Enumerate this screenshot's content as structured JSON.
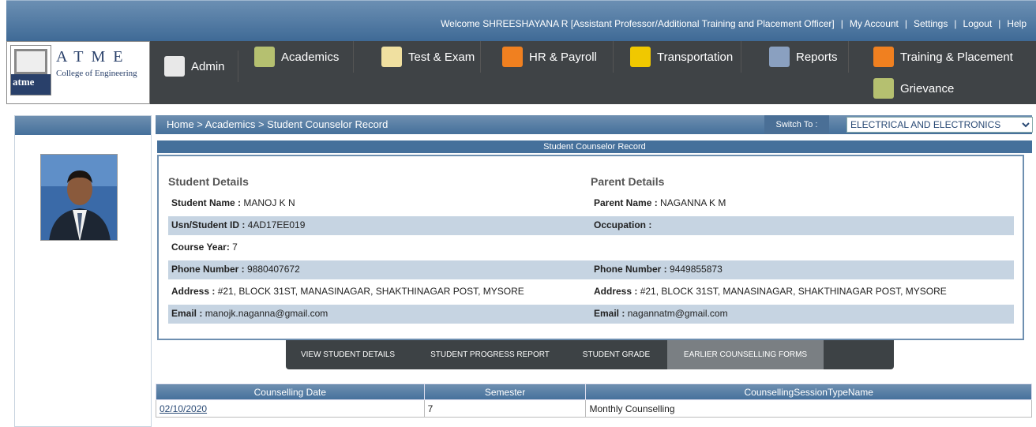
{
  "top": {
    "welcome": "Welcome SHREESHAYANA R [Assistant Professor/Additional Training and Placement Officer]",
    "my_account": "My Account",
    "settings": "Settings",
    "logout": "Logout",
    "help": "Help"
  },
  "logo": {
    "name": "ATME",
    "sub": "College of Engineering",
    "mark": "atme"
  },
  "menu": [
    "Admin",
    "Academics",
    "Test & Exam",
    "HR & Payroll",
    "Transportation",
    "Reports",
    "Training & Placement",
    "Grievance"
  ],
  "menu_icons": [
    "admin-icon",
    "academics-books-icon",
    "test-exam-icon",
    "hr-payroll-icon",
    "transportation-bus-icon",
    "reports-chart-icon",
    "training-placement-icon",
    "grievance-books-icon"
  ],
  "breadcrumb": {
    "path": "Home > Academics > Student Counselor Record",
    "switch_label": "Switch To :",
    "department": "ELECTRICAL AND ELECTRONICS"
  },
  "record_title": "Student Counselor Record",
  "student": {
    "heading": "Student Details",
    "rows": [
      [
        "Student Name : ",
        "MANOJ K N"
      ],
      [
        "Usn/Student ID : ",
        "4AD17EE019"
      ],
      [
        "Course Year: ",
        "7"
      ],
      [
        "Phone Number : ",
        "9880407672"
      ],
      [
        "Address : ",
        "#21, BLOCK 31ST, MANASINAGAR, SHAKTHINAGAR POST, MYSORE"
      ],
      [
        "Email : ",
        "manojk.naganna@gmail.com"
      ]
    ]
  },
  "parent": {
    "heading": "Parent Details",
    "rows": [
      [
        "Parent Name : ",
        "NAGANNA K M"
      ],
      [
        "Occupation : ",
        ""
      ],
      [
        "",
        ""
      ],
      [
        "Phone Number : ",
        "9449855873"
      ],
      [
        "Address : ",
        "#21, BLOCK 31ST, MANASINAGAR, SHAKTHINAGAR POST, MYSORE"
      ],
      [
        "Email : ",
        "nagannatm@gmail.com"
      ]
    ]
  },
  "tabs": [
    "VIEW STUDENT DETAILS",
    "STUDENT PROGRESS REPORT",
    "STUDENT GRADE",
    "EARLIER COUNSELLING FORMS"
  ],
  "active_tab": 3,
  "table": {
    "headers": [
      "Counselling Date",
      "Semester",
      "CounsellingSessionTypeName"
    ],
    "rows": [
      [
        "02/10/2020",
        "7",
        "Monthly Counselling"
      ]
    ]
  }
}
